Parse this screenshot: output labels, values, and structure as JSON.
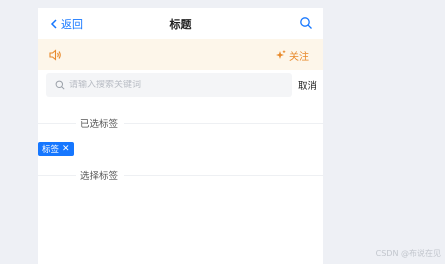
{
  "header": {
    "back_label": "返回",
    "title": "标题"
  },
  "notice": {
    "follow_label": "关注"
  },
  "search": {
    "placeholder": "请输入搜索关键词",
    "cancel_label": "取消"
  },
  "sections": {
    "selected_label": "已选标签",
    "choose_label": "选择标签"
  },
  "tags": [
    {
      "label": "标签",
      "remove_symbol": "✕"
    }
  ],
  "watermark": "CSDN @布说在见",
  "colors": {
    "accent": "#1677ff",
    "notice_bg": "#fdf6ea",
    "notice_fg": "#e8892b"
  }
}
